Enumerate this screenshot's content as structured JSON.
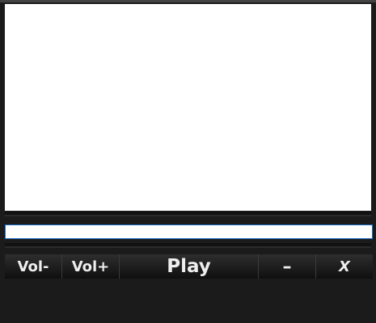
{
  "input": {
    "value": ""
  },
  "buttons": {
    "vol_down": "Vol-",
    "vol_up": "Vol+",
    "play": "Play",
    "minimize": "–",
    "close": "X"
  },
  "colors": {
    "focus_border": "#1a6fc9",
    "background": "#1b1b1b"
  }
}
